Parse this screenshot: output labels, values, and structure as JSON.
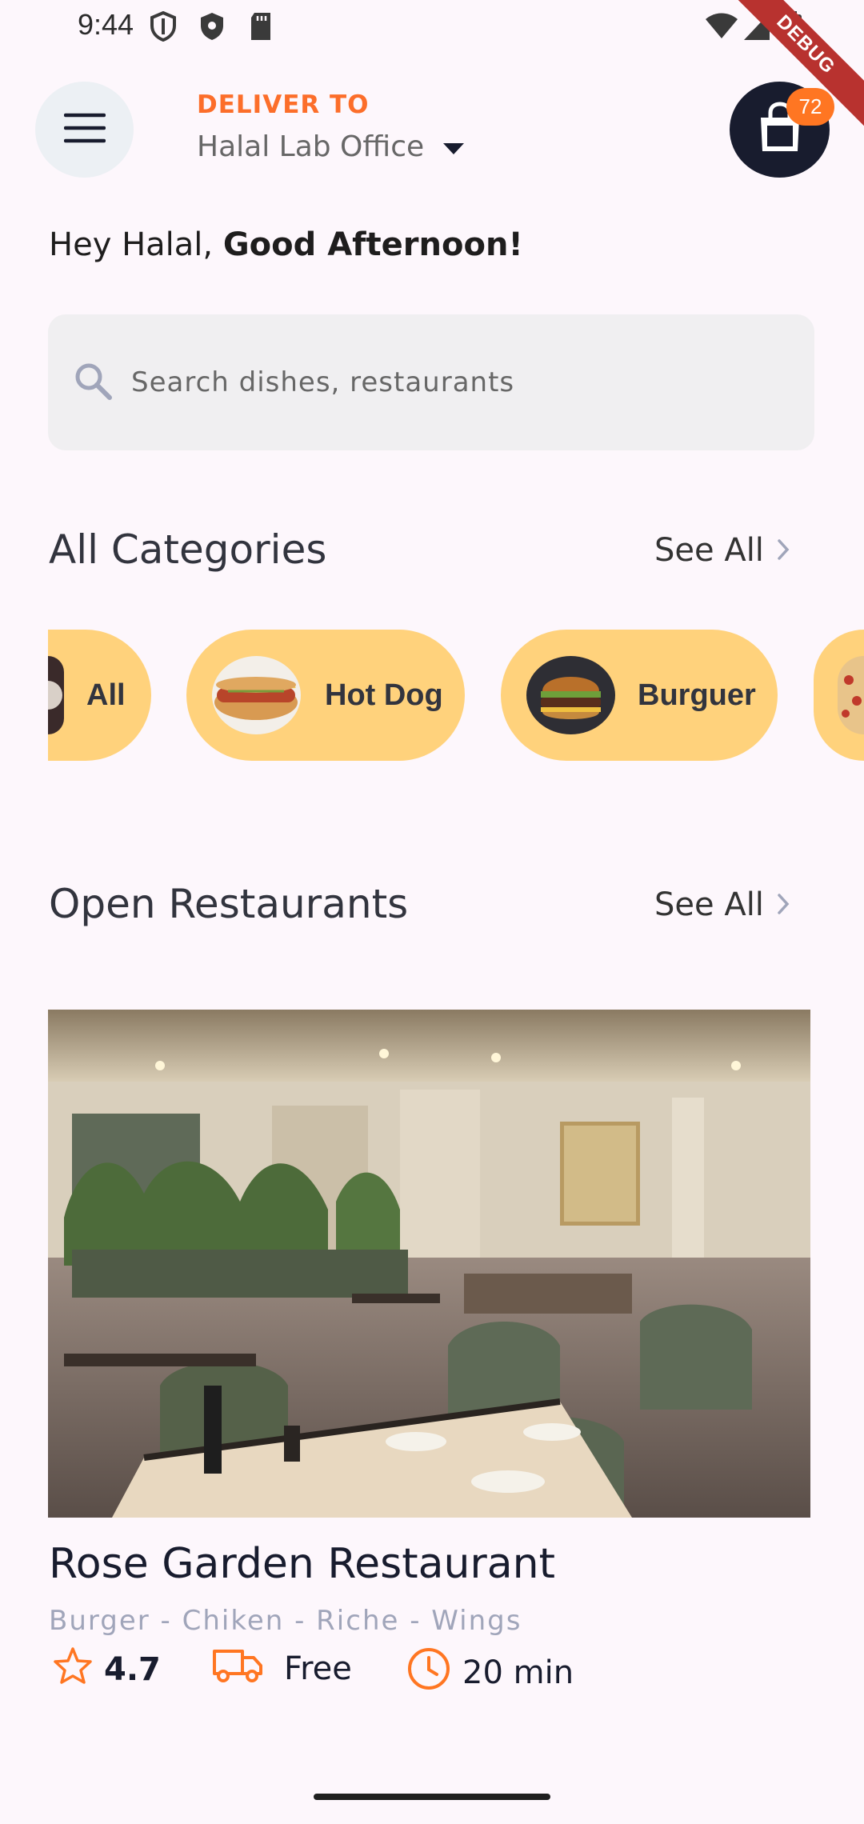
{
  "status_bar": {
    "time": "9:44",
    "debug_label": "DEBUG",
    "icons": [
      "shield-icon",
      "play-protect-icon",
      "sd-card-icon",
      "wifi-icon",
      "signal-icon",
      "battery-icon"
    ]
  },
  "header": {
    "deliver_label": "DELIVER TO",
    "location": "Halal Lab Office",
    "cart_count": "72"
  },
  "greeting": {
    "prefix": "Hey Halal, ",
    "emphasis": "Good Afternoon!"
  },
  "search": {
    "placeholder": "Search dishes, restaurants"
  },
  "categories": {
    "title": "All Categories",
    "see_all": "See All",
    "items": [
      {
        "label": "All",
        "icon": "all-food-image"
      },
      {
        "label": "Hot Dog",
        "icon": "hot-dog-image"
      },
      {
        "label": "Burguer",
        "icon": "burger-image"
      },
      {
        "label": "",
        "icon": "pizza-image"
      }
    ]
  },
  "restaurants": {
    "title": "Open Restaurants",
    "see_all": "See All",
    "items": [
      {
        "name": "Rose Garden Restaurant",
        "tags": "Burger - Chiken - Riche - Wings",
        "rating": "4.7",
        "delivery": "Free",
        "time": "20 min"
      }
    ]
  },
  "colors": {
    "accent": "#fc6e2a",
    "chip": "#ffd27c",
    "dark": "#181c2e",
    "background": "#fdf7fc"
  }
}
